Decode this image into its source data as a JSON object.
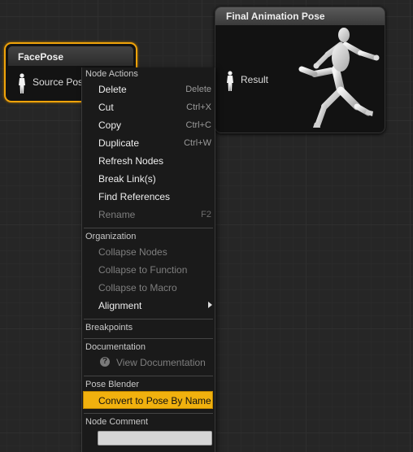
{
  "facepose_node": {
    "title": "FacePose",
    "pin_label": "Source Pose"
  },
  "final_node": {
    "title": "Final Animation Pose",
    "pin_label": "Result"
  },
  "menu": {
    "node_actions": {
      "header": "Node Actions",
      "items": [
        {
          "label": "Delete",
          "shortcut": "Delete"
        },
        {
          "label": "Cut",
          "shortcut": "Ctrl+X"
        },
        {
          "label": "Copy",
          "shortcut": "Ctrl+C"
        },
        {
          "label": "Duplicate",
          "shortcut": "Ctrl+W"
        },
        {
          "label": "Refresh Nodes",
          "shortcut": ""
        },
        {
          "label": "Break Link(s)",
          "shortcut": ""
        },
        {
          "label": "Find References",
          "shortcut": ""
        },
        {
          "label": "Rename",
          "shortcut": "F2"
        }
      ]
    },
    "organization": {
      "header": "Organization",
      "items": [
        {
          "label": "Collapse Nodes"
        },
        {
          "label": "Collapse to Function"
        },
        {
          "label": "Collapse to Macro"
        },
        {
          "label": "Alignment"
        }
      ]
    },
    "breakpoints": {
      "header": "Breakpoints"
    },
    "documentation": {
      "header": "Documentation",
      "item": "View Documentation"
    },
    "pose_blender": {
      "header": "Pose Blender",
      "item": "Convert to Pose By Name"
    },
    "node_comment": {
      "header": "Node Comment",
      "value": ""
    }
  },
  "icons": {
    "pose_pin": "pose-pin-icon",
    "mannequin": "running-mannequin-icon",
    "help": "question-circle-icon",
    "submenu": "chevron-right-icon"
  },
  "colors": {
    "selection": "#f1b10e",
    "node_selected_border": "#f0a30a"
  }
}
